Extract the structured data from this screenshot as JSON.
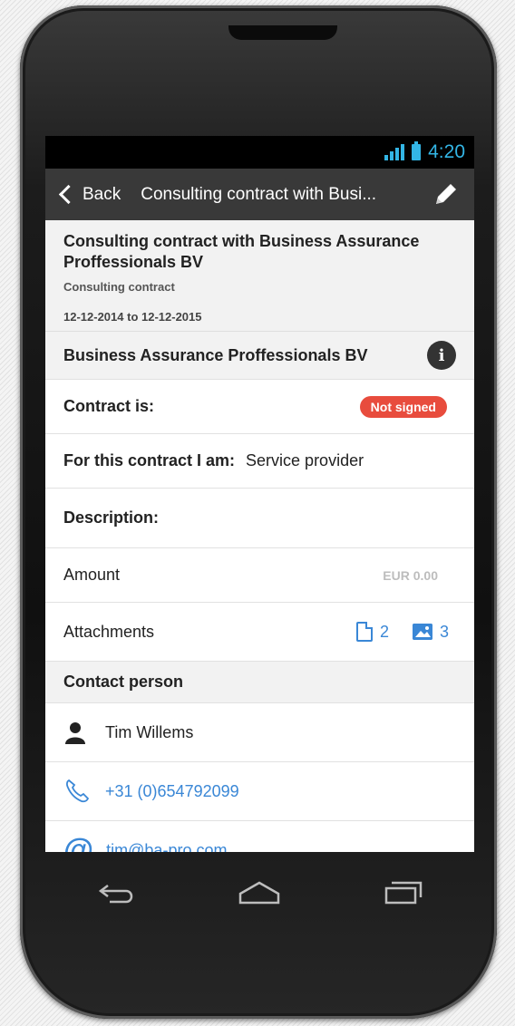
{
  "status": {
    "time": "4:20"
  },
  "actionbar": {
    "back_label": "Back",
    "title": "Consulting contract with Busi..."
  },
  "contract": {
    "title": "Consulting contract with Business Assurance Proffessionals BV",
    "type": "Consulting contract",
    "dates": "12-12-2014 to 12-12-2015",
    "company": "Business Assurance Proffessionals BV"
  },
  "rows": {
    "contract_is_label": "Contract is:",
    "contract_status": "Not signed",
    "role_label": "For this contract I am:",
    "role_value": "Service provider",
    "description_label": "Description:",
    "amount_label": "Amount",
    "amount_value": "EUR 0.00",
    "attachments_label": "Attachments",
    "attachments_files": "2",
    "attachments_images": "3"
  },
  "contact": {
    "section_label": "Contact person",
    "name": "Tim Willems",
    "phone": "+31 (0)654792099",
    "email": "tim@ba-pro.com"
  },
  "colors": {
    "accent": "#3a87d6",
    "status_badge": "#e84c3d",
    "actionbar": "#393939",
    "statusbar_icons": "#33b5e5"
  },
  "icons": [
    "signal-icon",
    "battery-icon",
    "back-chevron-icon",
    "pencil-icon",
    "info-icon",
    "file-icon",
    "image-icon",
    "person-icon",
    "phone-icon",
    "at-icon",
    "nav-back-icon",
    "nav-home-icon",
    "nav-recents-icon"
  ]
}
